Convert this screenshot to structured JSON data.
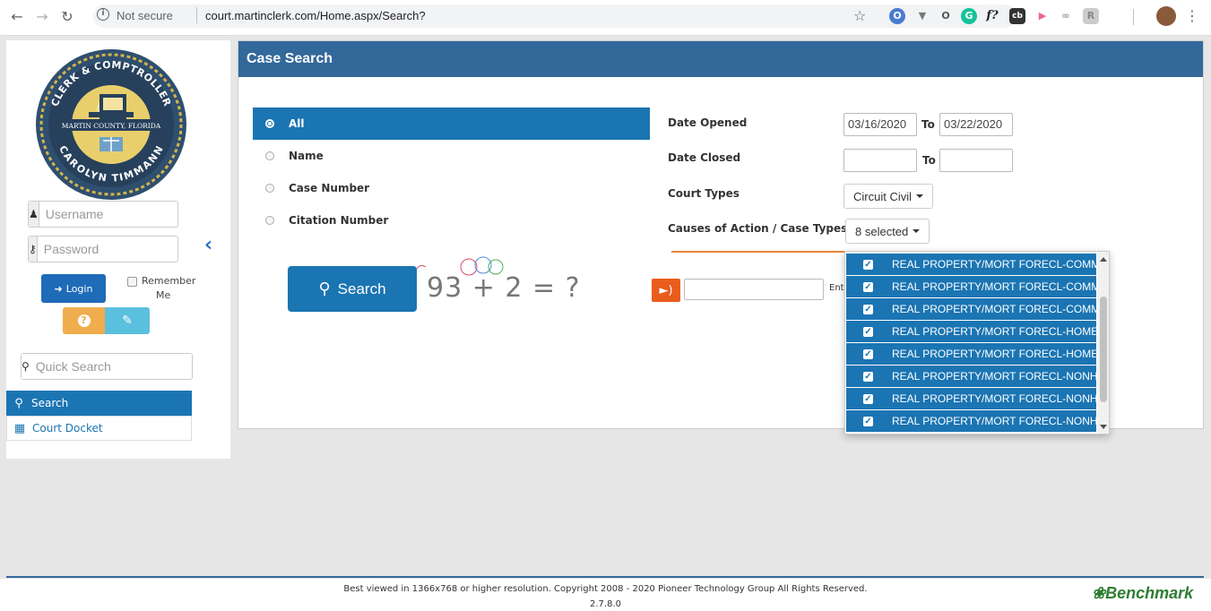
{
  "browser": {
    "security_label": "Not secure",
    "url": "court.martinclerk.com/Home.aspx/Search?",
    "info_symbol": "i",
    "extensions": [
      "O",
      "▼",
      "O",
      "G",
      "f?",
      "cb",
      "▶",
      "∞",
      "R"
    ]
  },
  "sidebar": {
    "seal": {
      "top_text": "CLERK & COMPTROLLER",
      "middle_text": "MARTIN COUNTY, FLORIDA",
      "bottom_text": "CAROLYN TIMMANN"
    },
    "username_placeholder": "Username",
    "password_placeholder": "Password",
    "login_label": "Login",
    "remember_line1": "Remember",
    "remember_line2": "Me",
    "quick_search_placeholder": "Quick Search",
    "menu": [
      {
        "label": "Search",
        "icon": "search-icon",
        "active": true
      },
      {
        "label": "Court Docket",
        "icon": "calendar-icon",
        "active": false
      }
    ]
  },
  "panel": {
    "title": "Case Search",
    "search_options": [
      {
        "label": "All",
        "selected": true
      },
      {
        "label": "Name",
        "selected": false
      },
      {
        "label": "Case Number",
        "selected": false
      },
      {
        "label": "Citation Number",
        "selected": false
      }
    ],
    "search_button": "Search",
    "captcha_text": "93 + 2 = ?",
    "captcha_hint": "Ent",
    "filters": {
      "date_opened_label": "Date Opened",
      "date_opened_from": "03/16/2020",
      "date_opened_to": "03/22/2020",
      "to_label": "To",
      "date_closed_label": "Date Closed",
      "date_closed_from": "",
      "date_closed_to": "",
      "court_types_label": "Court Types",
      "court_types_value": "Circuit Civil",
      "causes_label": "Causes of Action / Case Types",
      "causes_value": "8 selected"
    },
    "causes_options": [
      "REAL PROPERTY/MORT FORECL-COMMERCIAL",
      "REAL PROPERTY/MORT FORECL-COMMERCIAL",
      "REAL PROPERTY/MORT FORECL-COMMERCIAL",
      "REAL PROPERTY/MORT FORECL-HOMESTEAD",
      "REAL PROPERTY/MORT FORECL-HOMESTEAD",
      "REAL PROPERTY/MORT FORECL-NONHOMESTEAD",
      "REAL PROPERTY/MORT FORECL-NONHOMESTEAD",
      "REAL PROPERTY/MORT FORECL-NONHOMESTEAD"
    ]
  },
  "footer": {
    "copyright": "Best viewed in 1366x768 or higher resolution. Copyright 2008 - 2020 Pioneer Technology Group All Rights Reserved.",
    "version": "2.7.8.0",
    "brand": "Benchmark"
  },
  "colors": {
    "header_blue": "#33689b",
    "active_blue": "#1b75b3",
    "orange": "#e8863c",
    "warning": "#f0ad4e",
    "info": "#5bc0de"
  }
}
